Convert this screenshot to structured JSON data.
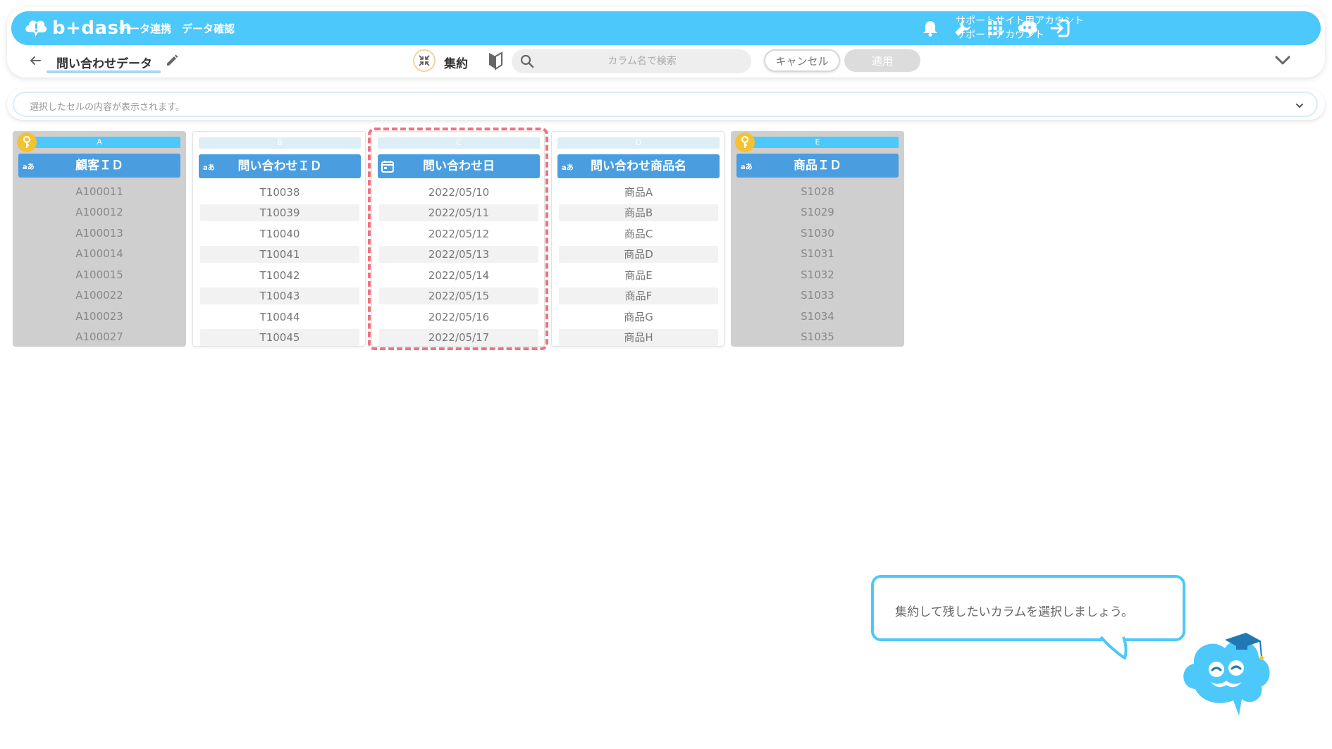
{
  "header": {
    "logo_text": "b+dash",
    "nav": [
      "データ連携",
      "データ確認"
    ],
    "account_line1": "サポートサイト用アカウント",
    "account_line2": "サポートアカウント",
    "icons": [
      "bell-icon",
      "wrench-icon",
      "apps-grid-icon",
      "mascot-help-icon",
      "logout-icon"
    ]
  },
  "subbar": {
    "dataset_title": "問い合わせデータ",
    "mode_label": "集約",
    "search_placeholder": "カラム名で検索",
    "cancel_label": "キャンセル",
    "apply_label": "適用"
  },
  "cellbar": {
    "placeholder": "選択したセルの内容が表示されます。"
  },
  "columns": [
    {
      "letter": "A",
      "name": "顧客ＩＤ",
      "type": "text",
      "type_badge": "aあ",
      "is_key": true,
      "cells": [
        "A100011",
        "A100012",
        "A100013",
        "A100014",
        "A100015",
        "A100022",
        "A100023",
        "A100027"
      ]
    },
    {
      "letter": "B",
      "name": "問い合わせＩＤ",
      "type": "text",
      "type_badge": "aあ",
      "is_key": false,
      "cells": [
        "T10038",
        "T10039",
        "T10040",
        "T10041",
        "T10042",
        "T10043",
        "T10044",
        "T10045"
      ]
    },
    {
      "letter": "C",
      "name": "問い合わせ日",
      "type": "date",
      "type_badge": "",
      "is_key": false,
      "cells": [
        "2022/05/10",
        "2022/05/11",
        "2022/05/12",
        "2022/05/13",
        "2022/05/14",
        "2022/05/15",
        "2022/05/16",
        "2022/05/17"
      ]
    },
    {
      "letter": "D",
      "name": "問い合わせ商品名",
      "type": "text",
      "type_badge": "aあ",
      "is_key": false,
      "cells": [
        "商品A",
        "商品B",
        "商品C",
        "商品D",
        "商品E",
        "商品F",
        "商品G",
        "商品H"
      ]
    },
    {
      "letter": "E",
      "name": "商品ＩＤ",
      "type": "text",
      "type_badge": "aあ",
      "is_key": true,
      "cells": [
        "S1028",
        "S1029",
        "S1030",
        "S1031",
        "S1032",
        "S1033",
        "S1034",
        "S1035"
      ]
    }
  ],
  "tooltip": {
    "text": "集約して残したいカラムを選択しましょう。"
  },
  "colors": {
    "brand": "#4cc8fb",
    "header_blue": "#4a9ee0",
    "highlight": "#f2717f",
    "key": "#f6c12f"
  }
}
